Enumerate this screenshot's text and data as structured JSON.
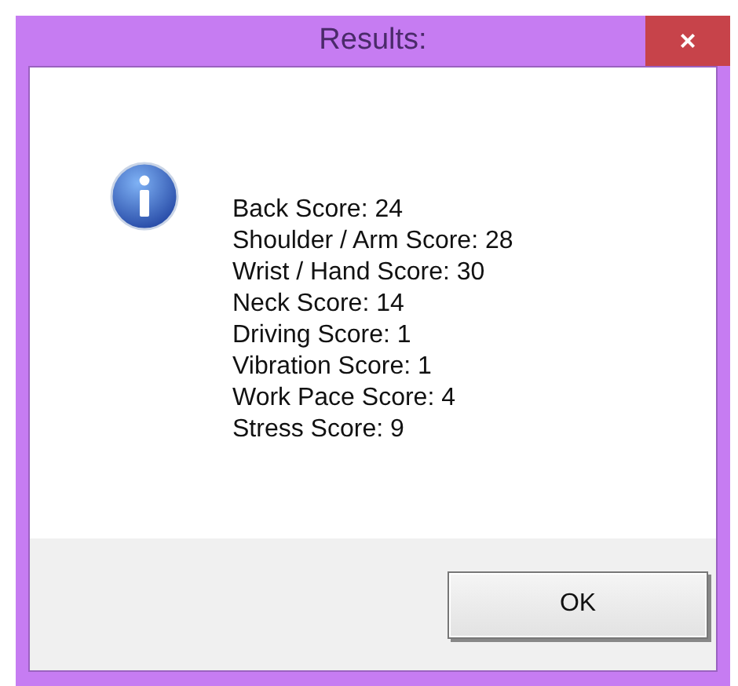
{
  "window": {
    "title": "Results:",
    "close": "×"
  },
  "message": {
    "lines": [
      "Back Score: 24",
      "Shoulder / Arm Score: 28",
      "Wrist / Hand Score: 30",
      "Neck Score: 14",
      "Driving Score: 1",
      "Vibration Score: 1",
      "Work Pace Score: 4",
      "Stress Score: 9"
    ]
  },
  "buttons": [
    "OK"
  ]
}
